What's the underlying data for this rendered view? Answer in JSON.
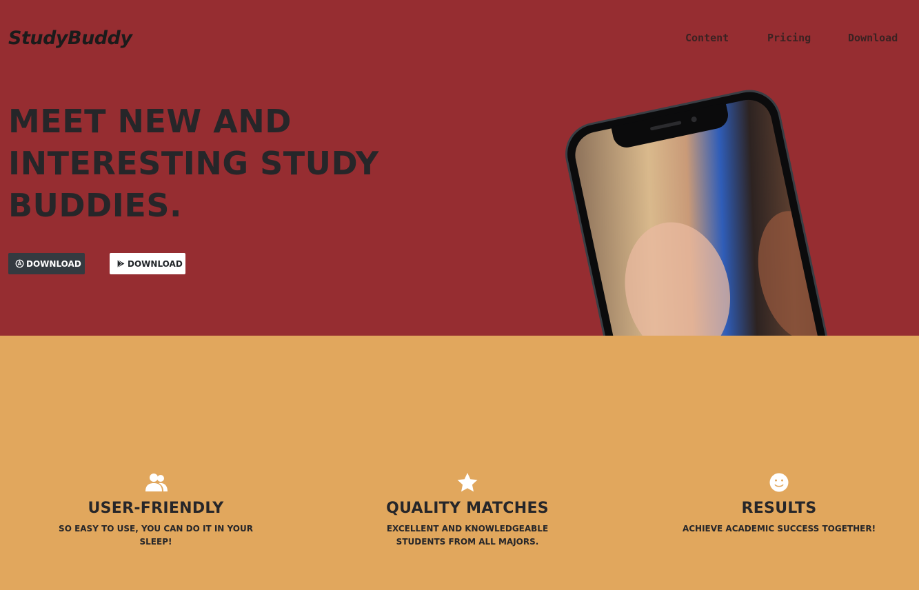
{
  "brand": "StudyBuddy",
  "nav": [
    {
      "label": "Content"
    },
    {
      "label": "Pricing"
    },
    {
      "label": "Download"
    }
  ],
  "hero": {
    "headline": "Meet new and interesting study buddies.",
    "buttons": [
      {
        "label": "Download",
        "icon": "apple-icon"
      },
      {
        "label": "Download",
        "icon": "google-play-icon"
      }
    ]
  },
  "features": [
    {
      "icon": "users-icon",
      "title": "User-Friendly",
      "text": "So easy to use, you can do it in your sleep!"
    },
    {
      "icon": "star-icon",
      "title": "Quality Matches",
      "text": "Excellent and knowledgeable students from all majors."
    },
    {
      "icon": "smile-icon",
      "title": "Results",
      "text": "Achieve academic success together!"
    }
  ],
  "colors": {
    "hero_bg": "#962d31",
    "features_bg": "#e1a75d",
    "dark_text": "#262629",
    "button_dark": "#343a40"
  }
}
